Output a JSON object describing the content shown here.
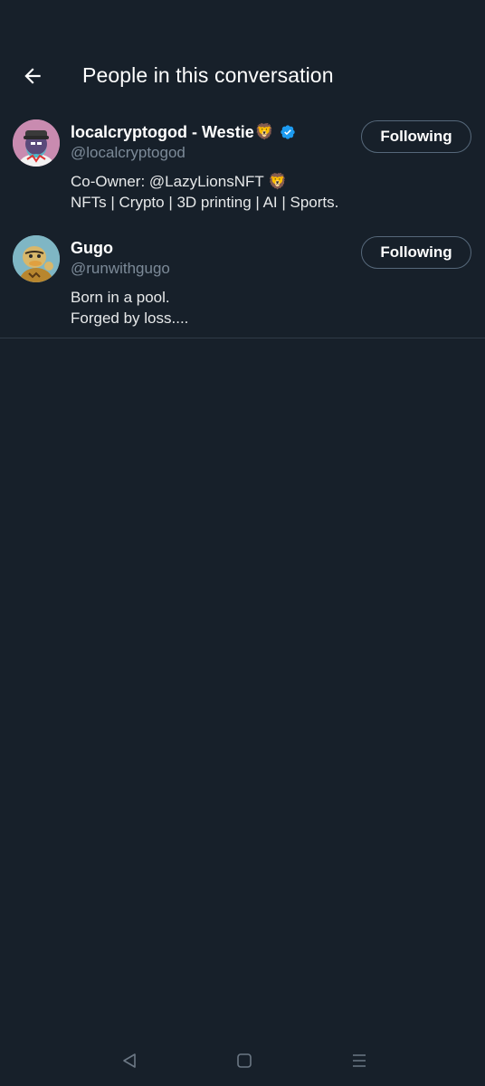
{
  "header": {
    "title": "People in this conversation",
    "back_icon": "arrow-left-icon"
  },
  "people": [
    {
      "display_name": "localcryptogod - Westie",
      "name_emoji": "🦁",
      "verified": true,
      "handle": "@localcryptogod",
      "bio_lines": [
        "Co-Owner: @LazyLionsNFT 🦁",
        "NFTs | Crypto | 3D printing | AI | Sports."
      ],
      "follow_label": "Following"
    },
    {
      "display_name": "Gugo",
      "name_emoji": "",
      "verified": false,
      "handle": "@runwithgugo",
      "bio_lines": [
        "Born in a pool.",
        "Forged by loss...."
      ],
      "follow_label": "Following"
    }
  ],
  "navbar": {
    "back": "nav-back-icon",
    "home": "nav-home-icon",
    "recents": "nav-recents-icon"
  },
  "colors": {
    "background": "#17202a",
    "verified_badge": "#1d9bf0",
    "secondary_text": "#7c8a98",
    "button_border": "#56687a"
  }
}
